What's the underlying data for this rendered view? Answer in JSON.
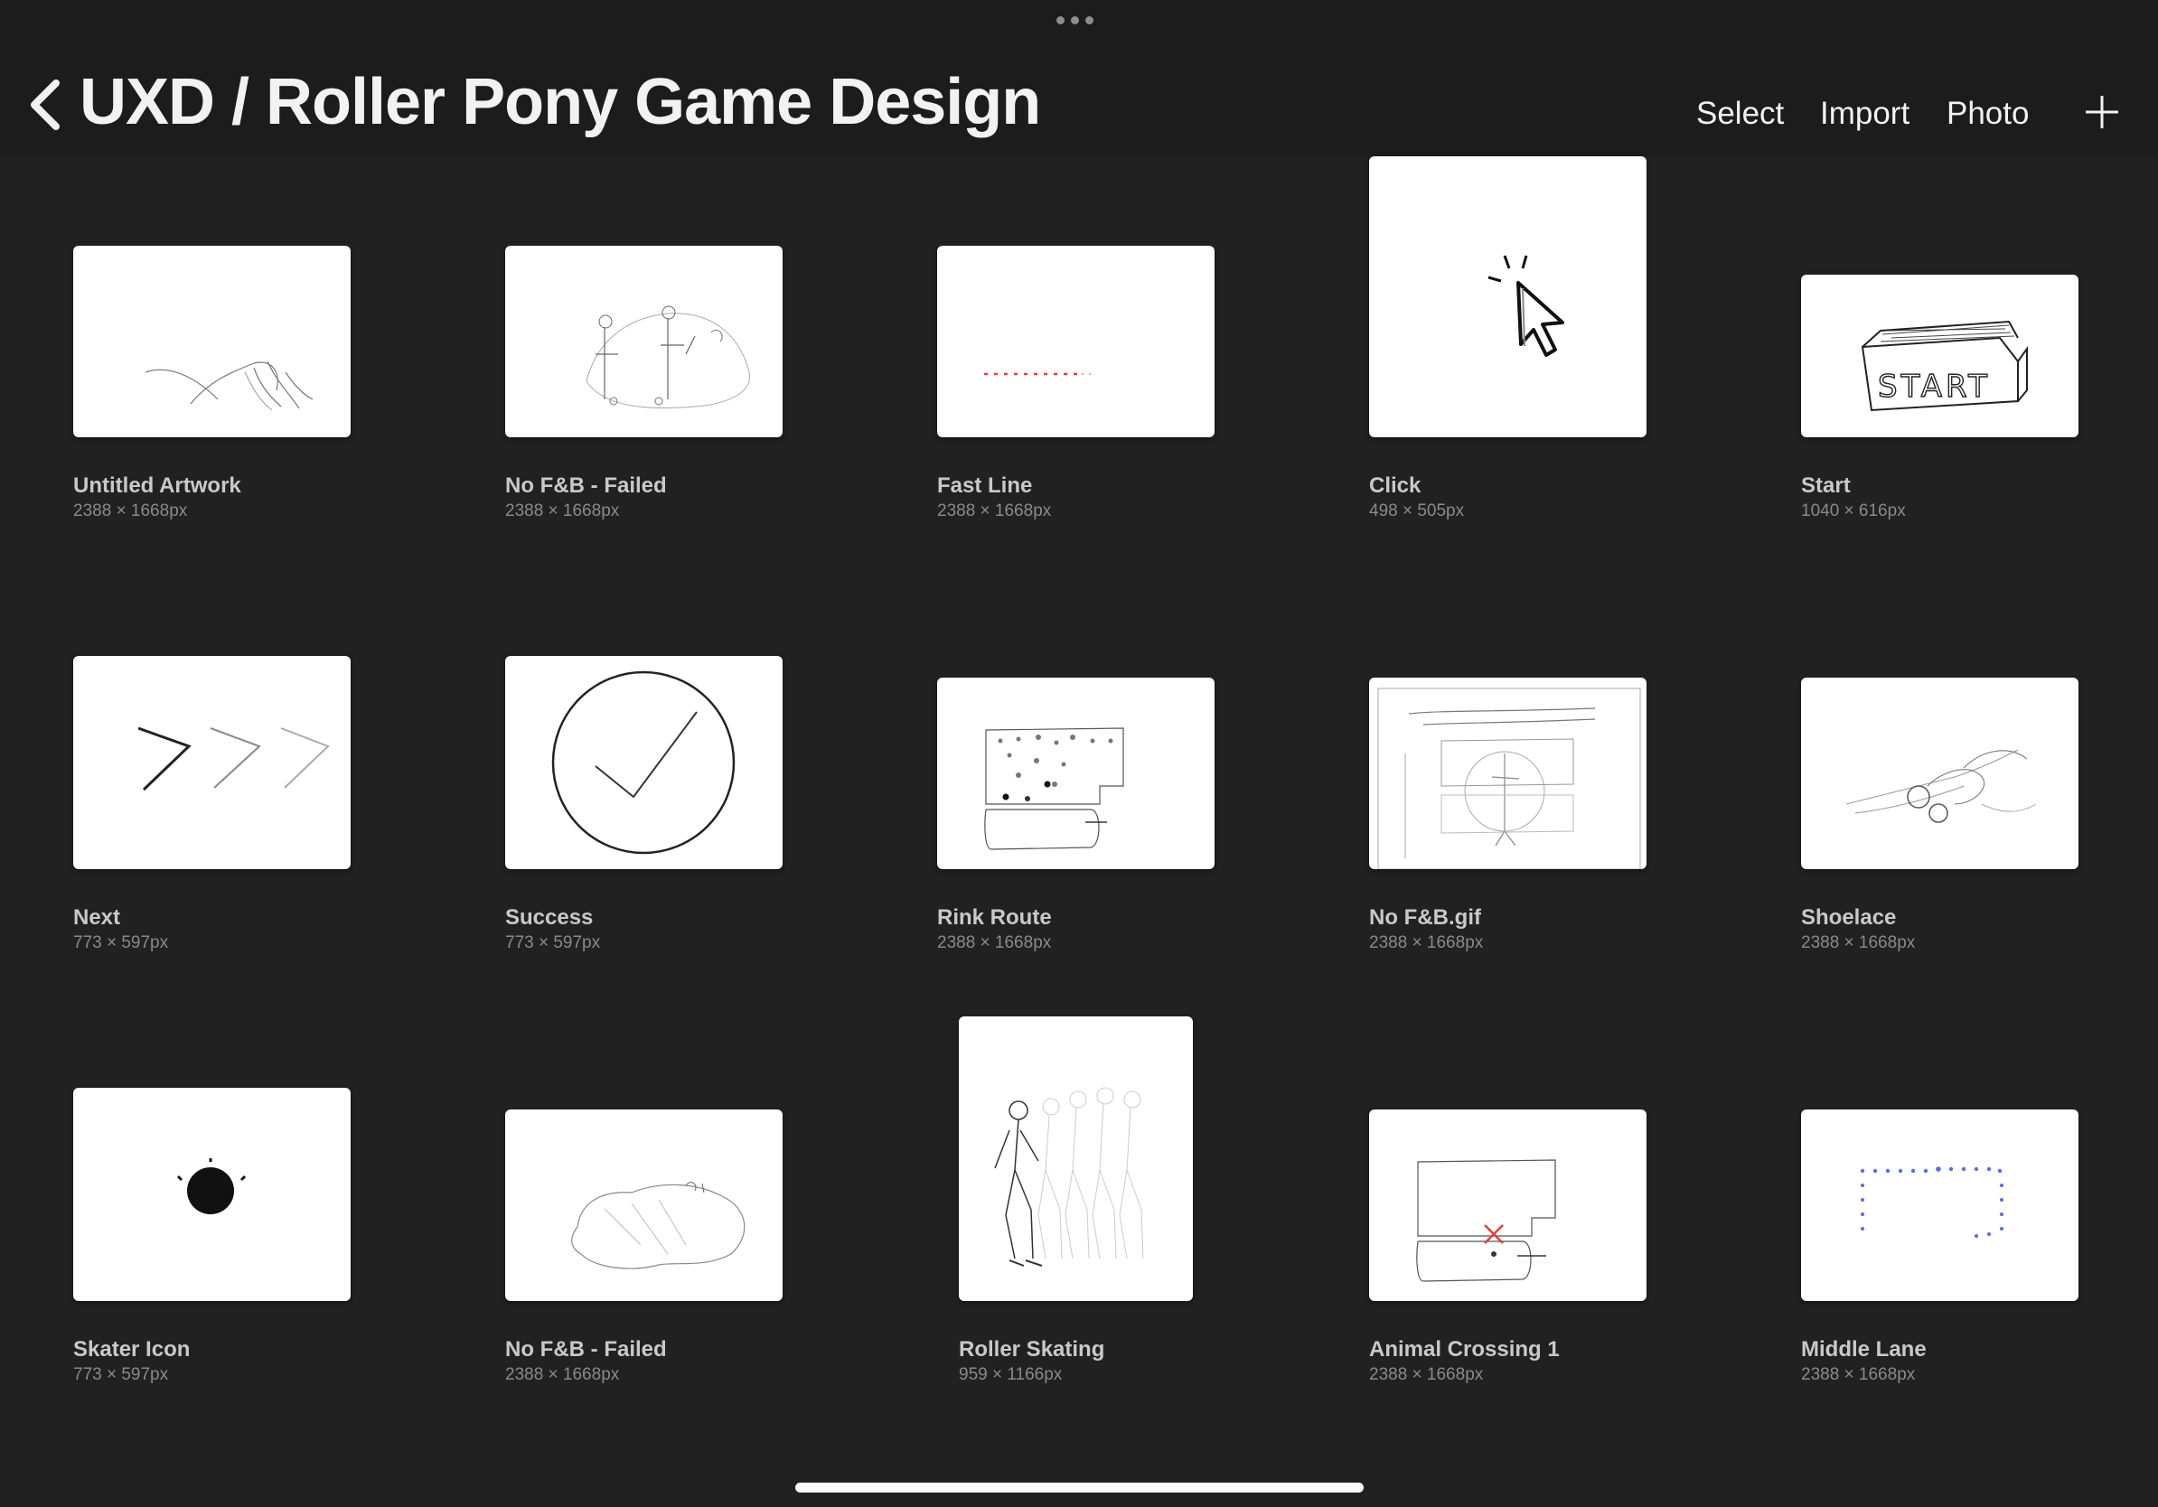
{
  "header": {
    "back_icon": "chevron-left-icon",
    "title": "UXD / Roller Pony Game Design",
    "actions": {
      "select": "Select",
      "import": "Import",
      "photo": "Photo"
    },
    "add_icon": "plus-icon",
    "more_icon": "ellipsis-icon"
  },
  "artworks": [
    {
      "name": "Untitled Artwork",
      "dims": "2388 × 1668px"
    },
    {
      "name": "No F&B - Failed",
      "dims": "2388 × 1668px"
    },
    {
      "name": "Fast Line",
      "dims": "2388 × 1668px"
    },
    {
      "name": "Click",
      "dims": "498 × 505px"
    },
    {
      "name": "Start",
      "dims": "1040 × 616px",
      "thumb_text": "START"
    },
    {
      "name": "Next",
      "dims": "773 × 597px"
    },
    {
      "name": "Success",
      "dims": "773 × 597px"
    },
    {
      "name": "Rink Route",
      "dims": "2388 × 1668px"
    },
    {
      "name": "No F&B.gif",
      "dims": "2388 × 1668px"
    },
    {
      "name": "Shoelace",
      "dims": "2388 × 1668px"
    },
    {
      "name": "Skater Icon",
      "dims": "773 × 597px"
    },
    {
      "name": "No F&B - Failed",
      "dims": "2388 × 1668px"
    },
    {
      "name": "Roller Skating",
      "dims": "959 × 1166px"
    },
    {
      "name": "Animal Crossing 1",
      "dims": "2388 × 1668px"
    },
    {
      "name": "Middle Lane",
      "dims": "2388 × 1668px"
    }
  ],
  "colors": {
    "background": "#212121",
    "header": "#1c1c1c",
    "caption_name": "#c9c9c9",
    "caption_dims": "#8a8a8a",
    "accent_red": "#e0403a",
    "accent_blue": "#5a6ee0"
  }
}
